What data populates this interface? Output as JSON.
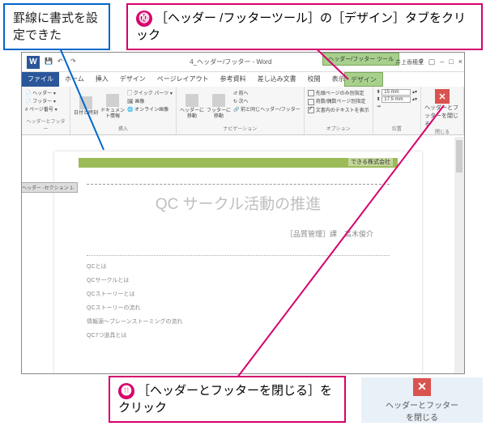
{
  "callouts": {
    "blue": "罫線に書式を設定できた",
    "magenta_top": "［ヘッダー /フッターツール］の［デザイン］タブをクリック",
    "magenta_bottom": "［ヘッダーとフッターを閉じる］をクリック",
    "step10": "⓾",
    "step11": "⓫"
  },
  "close_panel": {
    "label1": "ヘッダーとフッター",
    "label2": "を閉じる"
  },
  "titlebar": {
    "filename": "4_ヘッダー/フッター - Word",
    "tool": "ヘッダー/フッター ツール",
    "user": "井上香穂里"
  },
  "menu": {
    "file": "ファイル",
    "home": "ホーム",
    "insert": "挿入",
    "design": "デザイン",
    "layout": "ページレイアウト",
    "ref": "参考資料",
    "mail": "差し込み文書",
    "review": "校閲",
    "view": "表示",
    "tooldesign": "デザイン"
  },
  "ribbon": {
    "g1": {
      "header": "ヘッダー",
      "footer": "フッター",
      "pageno": "ページ番号",
      "label": "ヘッダーとフッター"
    },
    "g2": {
      "datetime": "日付と時刻",
      "docinfo": "ドキュメント情報",
      "quick": "クイック パーツ",
      "pic": "画像",
      "online": "オンライン画像",
      "label": "挿入"
    },
    "g3": {
      "goheader": "ヘッダーに移動",
      "gofooter": "フッターに移動",
      "prev": "前へ",
      "next": "次へ",
      "link": "前と同じヘッダー/フッター",
      "label": "ナビゲーション"
    },
    "g4": {
      "opt1": "先頭ページのみ別指定",
      "opt2": "奇数/偶数ページ別指定",
      "opt3": "文書内のテキストを表示",
      "label": "オプション"
    },
    "g5": {
      "top": "15 mm",
      "bottom": "17.5 mm",
      "label": "位置"
    },
    "g6": {
      "close": "ヘッダーとフッターを閉じる",
      "label": "閉じる"
    }
  },
  "doc": {
    "header_right": "できる株式会社",
    "section": "ヘッダー -セクション 1-",
    "title": "QC サークル活動の推進",
    "sub": "［品質管理］課　高木俊介",
    "toc": [
      "QCとは",
      "QCサークルとは",
      "QCストーリーとは",
      "QCストーリーの流れ",
      "情報源～ブレーンストーミングの流れ",
      "QC7つ道具とは"
    ]
  }
}
